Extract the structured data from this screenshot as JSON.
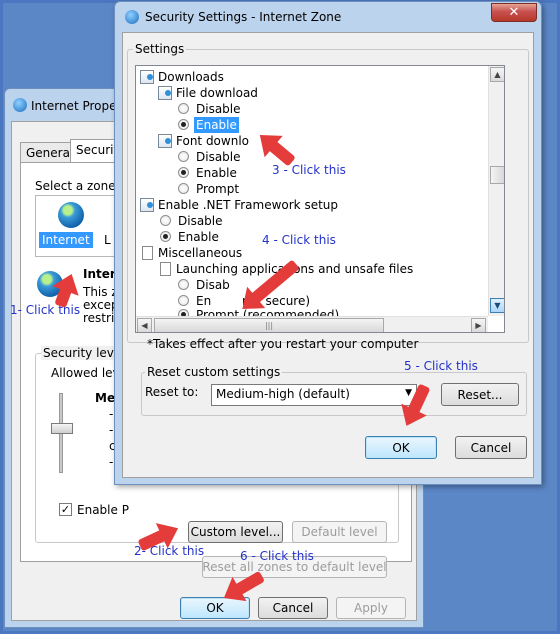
{
  "back_window": {
    "title": "Internet Propert",
    "tabs": [
      "General",
      "Security"
    ],
    "select_zone_text": "Select a zone to v",
    "zone_internet": "Internet",
    "zone_partial": "L",
    "internet_heading": "Interne",
    "internet_desc_1": "This zon",
    "internet_desc_2": "except t",
    "internet_desc_3": "restricte",
    "security_level_label": "Security level fo",
    "allowed_levels": "Allowed levels",
    "level_name": "Me",
    "level_bullets": [
      "-",
      "-",
      "co",
      "-"
    ],
    "enable_protected": "Enable P",
    "custom_level": "Custom level...",
    "default_level": "Default level",
    "reset_all": "Reset all zones to default level",
    "ok": "OK",
    "cancel": "Cancel",
    "apply": "Apply"
  },
  "front_window": {
    "title": "Security Settings - Internet Zone",
    "settings_group": "Settings",
    "tree": {
      "downloads": "Downloads",
      "file_download": "File download",
      "fd_disable": "Disable",
      "fd_enable": "Enable",
      "font_download": "Font downlo",
      "font_disable": "Disable",
      "font_enable": "Enable",
      "font_prompt": "Prompt",
      "dotnet": "Enable .NET Framework setup",
      "dotnet_disable": "Disable",
      "dotnet_enable": "Enable",
      "misc": "Miscellaneous",
      "launching": "Launching applications and unsafe files",
      "launch_disable": "Disab",
      "launch_enable": "En",
      "launch_enable_suffix": "not secure)",
      "launch_prompt": "Prompt (recommended)"
    },
    "restart_note": "*Takes effect after you restart your computer",
    "reset_group": "Reset custom settings",
    "reset_to": "Reset to:",
    "reset_value": "Medium-high (default)",
    "reset_button": "Reset...",
    "ok": "OK",
    "cancel": "Cancel"
  },
  "annotations": {
    "a1": "1- Click this",
    "a2": "2- Click this",
    "a3": "3 - Click this",
    "a4": "4 - Click this",
    "a5": "5 - Click this",
    "a6": "6 - Click this"
  },
  "colors": {
    "annotation_text": "#2432c8",
    "annotation_arrow": "#e43b3b",
    "selection": "#3399ff"
  }
}
